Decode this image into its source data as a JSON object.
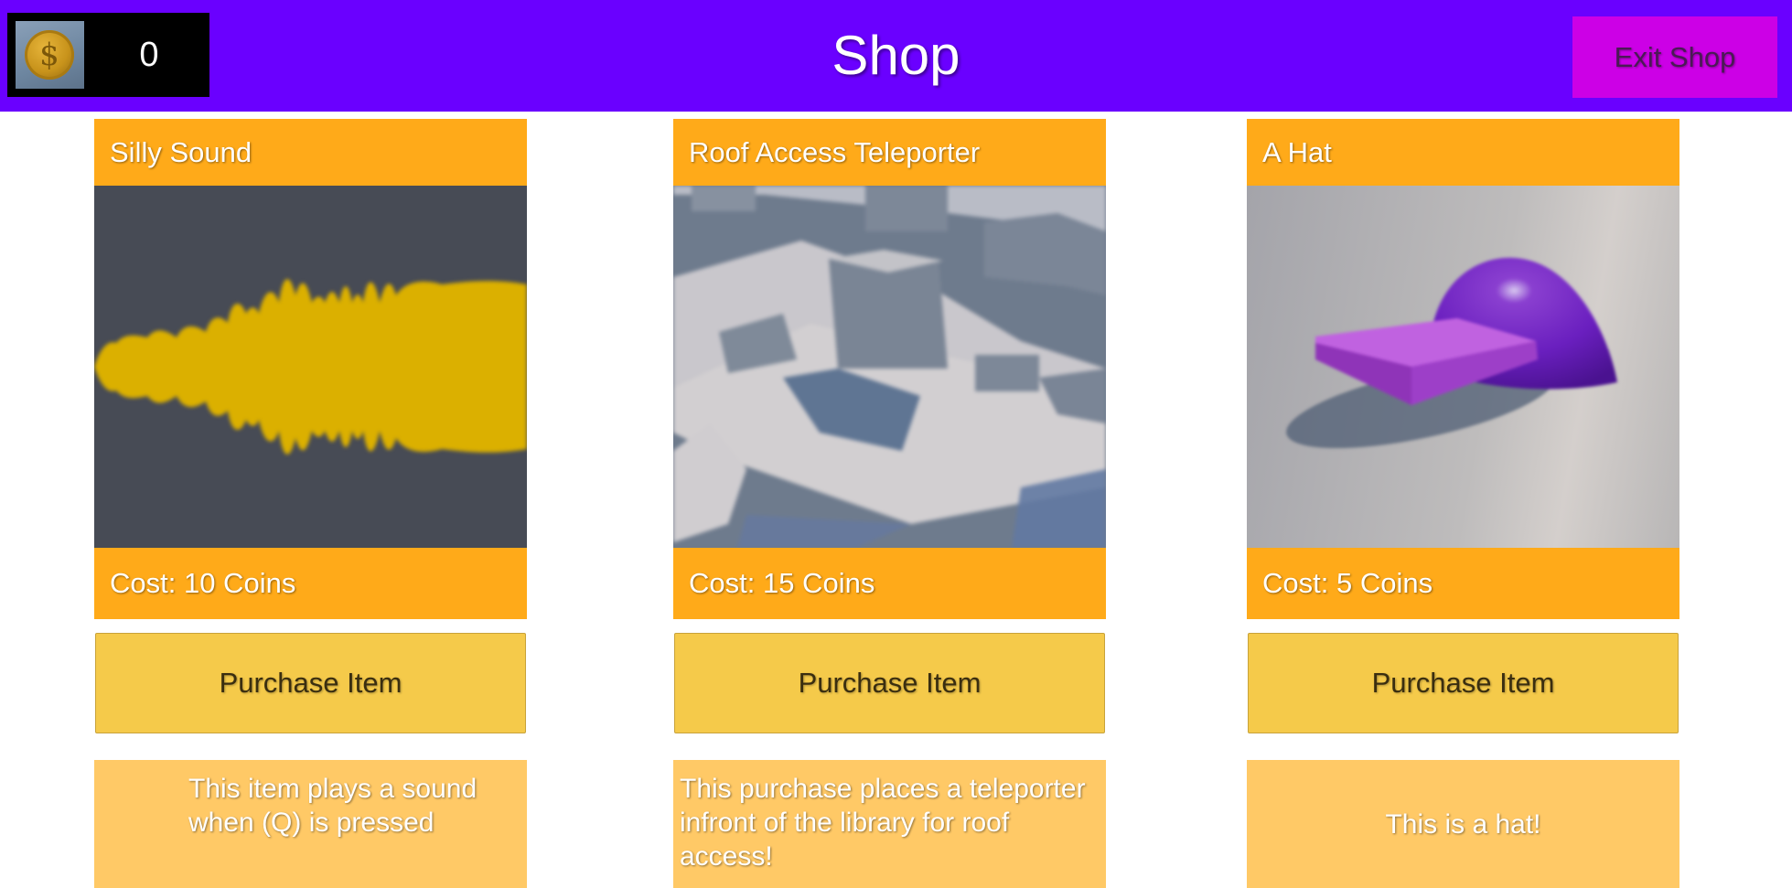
{
  "header": {
    "coins": "0",
    "title": "Shop",
    "exit_label": "Exit Shop"
  },
  "coin_icon": "dollar-coin-icon",
  "coin_glyph": "$",
  "colors": {
    "topbar": "#6a00ff",
    "exit_button": "#cc00e6",
    "card_header": "#ffaa19",
    "purchase_button": "#f5ca4a",
    "description": "#ffc966"
  },
  "items": [
    {
      "name": "Silly Sound",
      "image": "sound-waveform-image",
      "cost": "Cost: 10 Coins",
      "button": "Purchase Item",
      "description": "This item plays a sound when (Q) is pressed"
    },
    {
      "name": "Roof Access Teleporter",
      "image": "rooftop-scene-image",
      "cost": "Cost: 15 Coins",
      "button": "Purchase Item",
      "description": "This purchase places a teleporter infront of the library for roof access!"
    },
    {
      "name": "A Hat",
      "image": "purple-cap-image",
      "cost": "Cost: 5 Coins",
      "button": "Purchase Item",
      "description": "This is a hat!"
    }
  ]
}
